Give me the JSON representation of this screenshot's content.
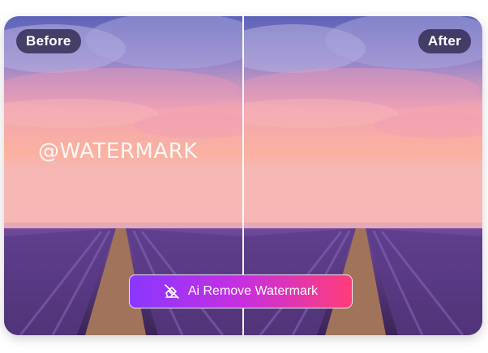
{
  "labels": {
    "before": "Before",
    "after": "After"
  },
  "overlay": {
    "watermark_text": "@WATERMARK"
  },
  "action": {
    "button_label": "Ai Remove Watermark",
    "icon": "eraser-icon"
  },
  "colors": {
    "button_gradient_start": "#8a37ff",
    "button_gradient_end": "#ff3d7a",
    "pill_background": "#2b264a"
  }
}
